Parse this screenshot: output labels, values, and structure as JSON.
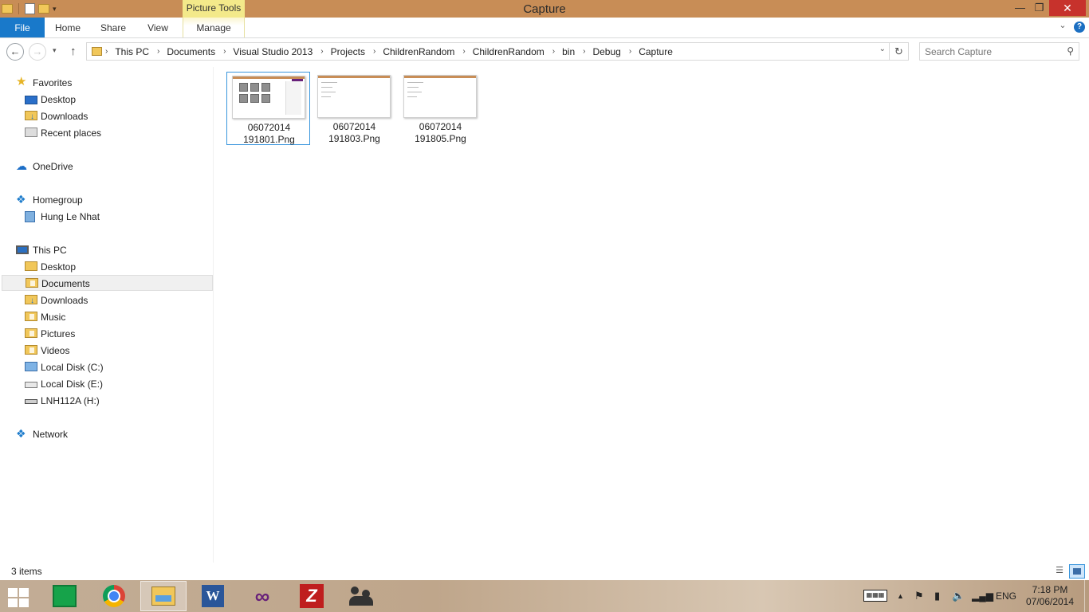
{
  "window": {
    "title": "Capture",
    "contextual_tab_group": "Picture Tools",
    "minimize_glyph": "—",
    "maximize_glyph": "❐",
    "close_glyph": "✕"
  },
  "ribbon": {
    "tabs": [
      "File",
      "Home",
      "Share",
      "View",
      "Manage"
    ],
    "expand_glyph": "⌄",
    "help_glyph": "?"
  },
  "address": {
    "back_glyph": "←",
    "forward_glyph": "→",
    "recent_glyph": "▾",
    "up_glyph": "↑",
    "breadcrumb": [
      "This PC",
      "Documents",
      "Visual Studio 2013",
      "Projects",
      "ChildrenRandom",
      "ChildrenRandom",
      "bin",
      "Debug",
      "Capture"
    ],
    "separator": "›",
    "dropdown_glyph": "⌄",
    "refresh_glyph": "↻"
  },
  "search": {
    "placeholder": "Search Capture",
    "icon": "search-icon",
    "glyph": "⚲"
  },
  "nav": {
    "favorites": {
      "label": "Favorites",
      "items": [
        "Desktop",
        "Downloads",
        "Recent places"
      ]
    },
    "onedrive": "OneDrive",
    "homegroup": {
      "label": "Homegroup",
      "items": [
        "Hung Le Nhat"
      ]
    },
    "thispc": {
      "label": "This PC",
      "items": [
        "Desktop",
        "Documents",
        "Downloads",
        "Music",
        "Pictures",
        "Videos",
        "Local Disk (C:)",
        "Local Disk (E:)",
        "LNH112A (H:)"
      ]
    },
    "network": "Network",
    "selected": "Documents",
    "glyphs": {
      "star": "★",
      "cloud": "☁",
      "homegroup": "❖",
      "network": "❖"
    }
  },
  "files": [
    {
      "line1": "06072014",
      "line2": "191801.Png"
    },
    {
      "line1": "06072014",
      "line2": "191803.Png"
    },
    {
      "line1": "06072014",
      "line2": "191805.Png"
    }
  ],
  "status": {
    "count": "3 items",
    "details_glyph": "☰"
  },
  "taskbar": {
    "tray": {
      "lang": "ENG",
      "time": "7:18 PM",
      "date": "07/06/2014",
      "overflow_glyph": "▲",
      "flag_glyph": "⚑",
      "power_glyph": "▮",
      "volume_glyph": "🔈",
      "network_glyph": "▂▄▆"
    },
    "apps": {
      "word_glyph": "W",
      "vs_glyph": "∞",
      "filezilla_glyph": "Z"
    }
  },
  "colors": {
    "titlebar": "#c88d56",
    "file_tab": "#1979ca",
    "picture_tools": "#f3e98a",
    "selection_border": "#3a96dd",
    "close_button": "#c7322c"
  }
}
